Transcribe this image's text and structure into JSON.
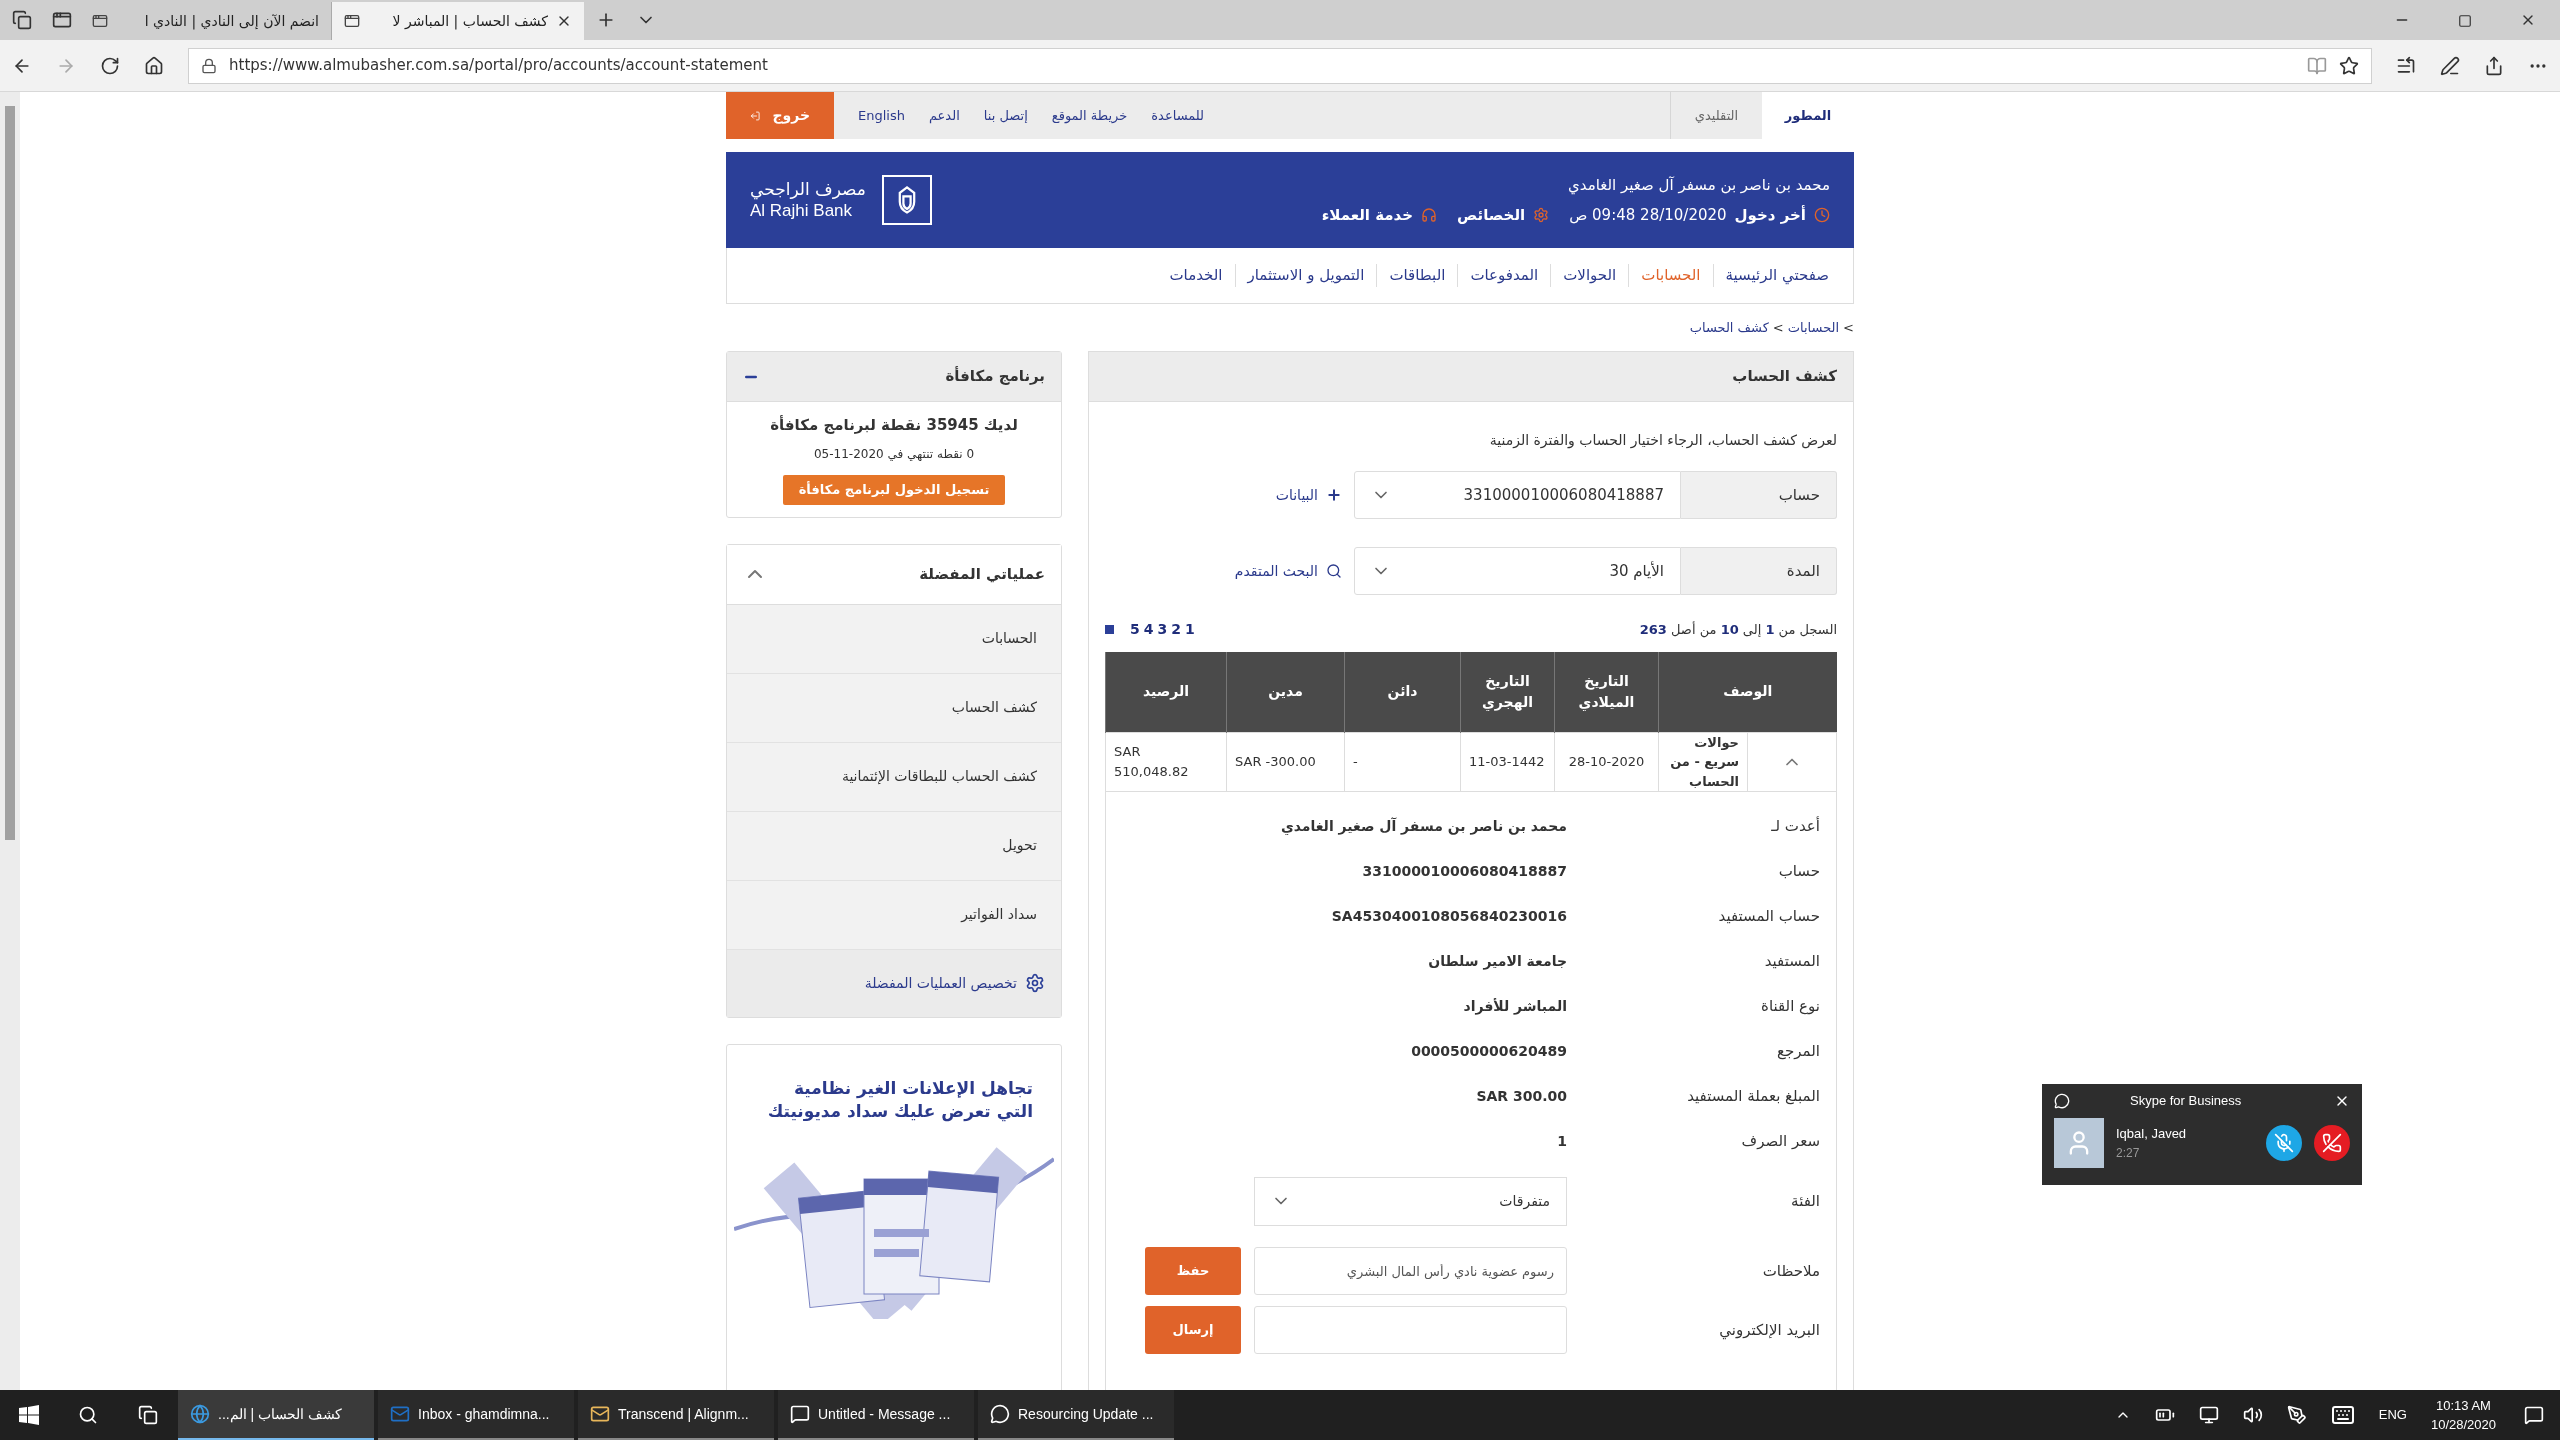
{
  "browser": {
    "tabs": [
      {
        "title": "كشف الحساب | المباشر لا",
        "selected": true
      },
      {
        "title": "انضم الآن إلى النادي | النادي ا",
        "selected": false
      }
    ],
    "url": "https://www.almubasher.com.sa/portal/pro/accounts/account-statement"
  },
  "top_bar": {
    "modes": [
      {
        "label": "المطور",
        "selected": true
      },
      {
        "label": "التقليدي",
        "selected": false
      }
    ],
    "links": [
      "للمساعدة",
      "خريطة الموقع",
      "إتصل بنا",
      "الدعم",
      "English"
    ],
    "logout": "خروج"
  },
  "header": {
    "user_name": "محمد بن ناصر بن مسفر آل صغير الغامدي",
    "last_login_label": "أخر دخول",
    "last_login": "28/10/2020 09:48 ص",
    "settings": "الخصائص",
    "support": "خدمة العملاء",
    "bank_name_ar": "مصرف الراجحي",
    "bank_name_en": "Al Rajhi Bank"
  },
  "nav": [
    {
      "label": "صفحتي الرئيسية",
      "selected": false
    },
    {
      "label": "الحسابات",
      "selected": true
    },
    {
      "label": "الحوالات",
      "selected": false
    },
    {
      "label": "المدفوعات",
      "selected": false
    },
    {
      "label": "البطاقات",
      "selected": false
    },
    {
      "label": "التمويل و الاستثمار",
      "selected": false
    },
    {
      "label": "الخدمات",
      "selected": false
    }
  ],
  "breadcrumb": {
    "separator": ">",
    "items": [
      "الحسابات",
      "كشف الحساب"
    ]
  },
  "statement": {
    "title": "كشف الحساب",
    "instruction": "لعرض كشف الحساب، الرجاء اختيار الحساب والفترة الزمنية",
    "account": {
      "label": "حساب",
      "value": "331000010006080418887",
      "link": "البيانات"
    },
    "period": {
      "label": "المدة",
      "value": "الأيام 30",
      "link": "البحث المتقدم"
    },
    "records": "السجل من **1** إلى **10** من أصل **263**",
    "pages": [
      "1",
      "2",
      "3",
      "4",
      "5"
    ],
    "columns": [
      "الوصف",
      "التاريخ الميلادي",
      "التاريخ الهجري",
      "دائن",
      "مدين",
      "الرصيد"
    ],
    "rows": [
      {
        "expanded": true,
        "cells": [
          "حوالات سريع - من الحساب",
          "28-10-2020",
          "11-03-1442",
          "-",
          "SAR -300.00",
          "SAR 510,048.82"
        ]
      }
    ],
    "details": [
      {
        "label": "أعدت لـ",
        "value": "محمد بن ناصر بن مسفر آل صغير الغامدي"
      },
      {
        "label": "حساب",
        "value": "331000010006080418887"
      },
      {
        "label": "حساب المستفيد",
        "value": "SA4530400108056840230016"
      },
      {
        "label": "المستفيد",
        "value": "جامعة الامير سلطان"
      },
      {
        "label": "نوع القناة",
        "value": "المباشر للأفراد"
      },
      {
        "label": "المرجع",
        "value": "0000500000620489"
      },
      {
        "label": "المبلغ بعملة المستفيد",
        "value": "SAR 300.00"
      },
      {
        "label": "سعر الصرف",
        "value": "1"
      }
    ],
    "category": {
      "label": "الفئة",
      "value": "متفرقات"
    },
    "notes": {
      "label": "ملاحظات",
      "value": "رسوم عضوية نادي رأس المال البشري",
      "button": "حفظ"
    },
    "email": {
      "label": "البريد الإلكتروني",
      "button": "إرسال"
    }
  },
  "sidebar": {
    "rewards": {
      "title": "برنامج مكافأة",
      "expanded": true,
      "points": "لديك 35945 نقطة لبرنامج مكافأة",
      "expiry": "0 نقطه تنتهي في 2020-11-05",
      "button": "تسجيل الدخول لبرنامج مكافأة"
    },
    "favorites": {
      "title": "عملياتي المفضلة",
      "expanded": true,
      "items": [
        "الحسابات",
        "كشف الحساب",
        "كشف الحساب للبطاقات الإئتمانية",
        "تحويل",
        "سداد الفواتير"
      ],
      "customize": "تخصيص العمليات المفضلة"
    },
    "ad": {
      "lines": [
        "تجاهل الإعلانات الغير نظامية",
        "التي تعرض عليك سداد مديونيتك"
      ]
    }
  },
  "skype": {
    "title": "Skype for Business",
    "caller": "Iqbal, Javed",
    "duration": "2:27",
    "muted": true
  },
  "taskbar": {
    "apps": [
      {
        "kind": "chat",
        "label": "Resourcing Update ...",
        "selected": false
      },
      {
        "kind": "message",
        "label": "Untitled - Message ...",
        "selected": false
      },
      {
        "kind": "mail",
        "label": "Transcend | Alignm...",
        "selected": false
      },
      {
        "kind": "outlook",
        "label": "Inbox - ghamdimna...",
        "selected": false
      },
      {
        "kind": "browser",
        "label": "كشف الحساب | الم...",
        "selected": true
      }
    ],
    "language": "ENG",
    "time": "10:13 AM",
    "date": "10/28/2020"
  }
}
